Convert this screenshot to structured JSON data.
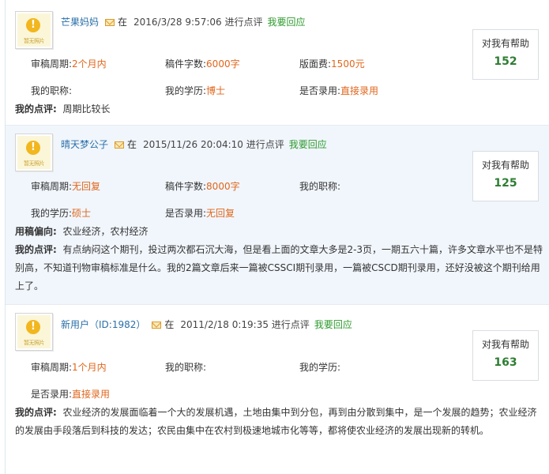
{
  "reviews": [
    {
      "avatar_caption": "暂无照片",
      "username": "芒果妈妈",
      "at": "在",
      "timestamp": "2016/3/28 9:57:06 进行点评",
      "reply": "我要回应",
      "fields": [
        {
          "label": "审稿周期:",
          "value": "2个月内"
        },
        {
          "label": "稿件字数:",
          "value": "6000字"
        },
        {
          "label": "版面费:",
          "value": "1500元"
        },
        {
          "label": "我的职称:",
          "value": ""
        },
        {
          "label": "我的学历:",
          "value": "博士"
        },
        {
          "label": "是否录用:",
          "value": "直接录用"
        }
      ],
      "comment_label": "我的点评:",
      "comment": "周期比较长",
      "help_label": "对我有帮助",
      "help_count": "152"
    },
    {
      "avatar_caption": "暂无照片",
      "username": "晴天梦公子",
      "at": "在",
      "timestamp": "2015/11/26 20:04:10 进行点评",
      "reply": "我要回应",
      "fields": [
        {
          "label": "审稿周期:",
          "value": "无回复"
        },
        {
          "label": "稿件字数:",
          "value": "8000字"
        },
        {
          "label": "我的职称:",
          "value": ""
        },
        {
          "label": "我的学历:",
          "value": "硕士"
        },
        {
          "label": "是否录用:",
          "value": "无回复"
        }
      ],
      "pref_label": "用稿偏向:",
      "pref": "农业经济，农村经济",
      "comment_label": "我的点评:",
      "comment": "有点纳闷这个期刊，投过两次都石沉大海，但是看上面的文章大多是2-3页，一期五六十篇，许多文章水平也不是特别高，不知道刊物审稿标准是什么。我的2篇文章后来一篇被CSSCI期刊录用，一篇被CSCD期刊录用，还好没被这个期刊给用上了。",
      "help_label": "对我有帮助",
      "help_count": "125"
    },
    {
      "avatar_caption": "暂无照片",
      "username": "新用户（ID:1982）",
      "at": "在",
      "timestamp": "2011/2/18 0:19:35 进行点评",
      "reply": "我要回应",
      "fields": [
        {
          "label": "审稿周期:",
          "value": "1个月内"
        },
        {
          "label": "我的职称:",
          "value": ""
        },
        {
          "label": "我的学历:",
          "value": ""
        },
        {
          "label": "是否录用:",
          "value": "直接录用"
        }
      ],
      "comment_label": "我的点评:",
      "comment": "农业经济的发展面临着一个大的发展机遇，土地由集中到分包，再到由分散到集中，是一个发展的趋势；农业经济的发展由手段落后到科技的发达；农民由集中在农村到极速地城市化等等，都将使农业经济的发展出现新的转机。",
      "help_label": "对我有帮助",
      "help_count": "163"
    }
  ]
}
